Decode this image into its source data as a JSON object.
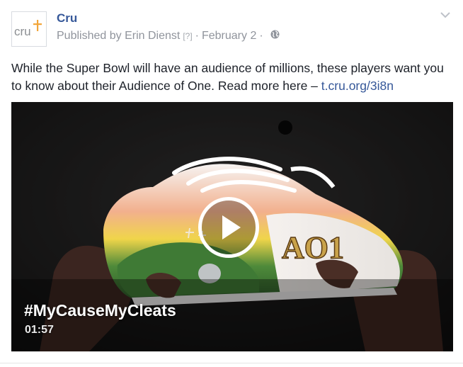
{
  "header": {
    "page_name": "Cru",
    "avatar_text": "cru",
    "published_by": "Published by Erin Dienst",
    "info_mark": "[?]",
    "separator": "·",
    "date": "February 2",
    "audience_icon": "globe-icon",
    "menu_icon": "chevron-down-icon"
  },
  "post": {
    "text": "While the Super Bowl will have an audience of millions, these players want you to know about their Audience of One. Read more here –",
    "link_text": "t.cru.org/3i8n"
  },
  "video": {
    "title": "#MyCauseMyCleats",
    "duration": "01:57",
    "play_icon": "play-icon",
    "cleat_text": "AO1"
  },
  "colors": {
    "link": "#365899",
    "meta": "#90949c",
    "text": "#1d2129",
    "brand_orange": "#f2a63a",
    "brand_gray": "#8c8f93"
  }
}
